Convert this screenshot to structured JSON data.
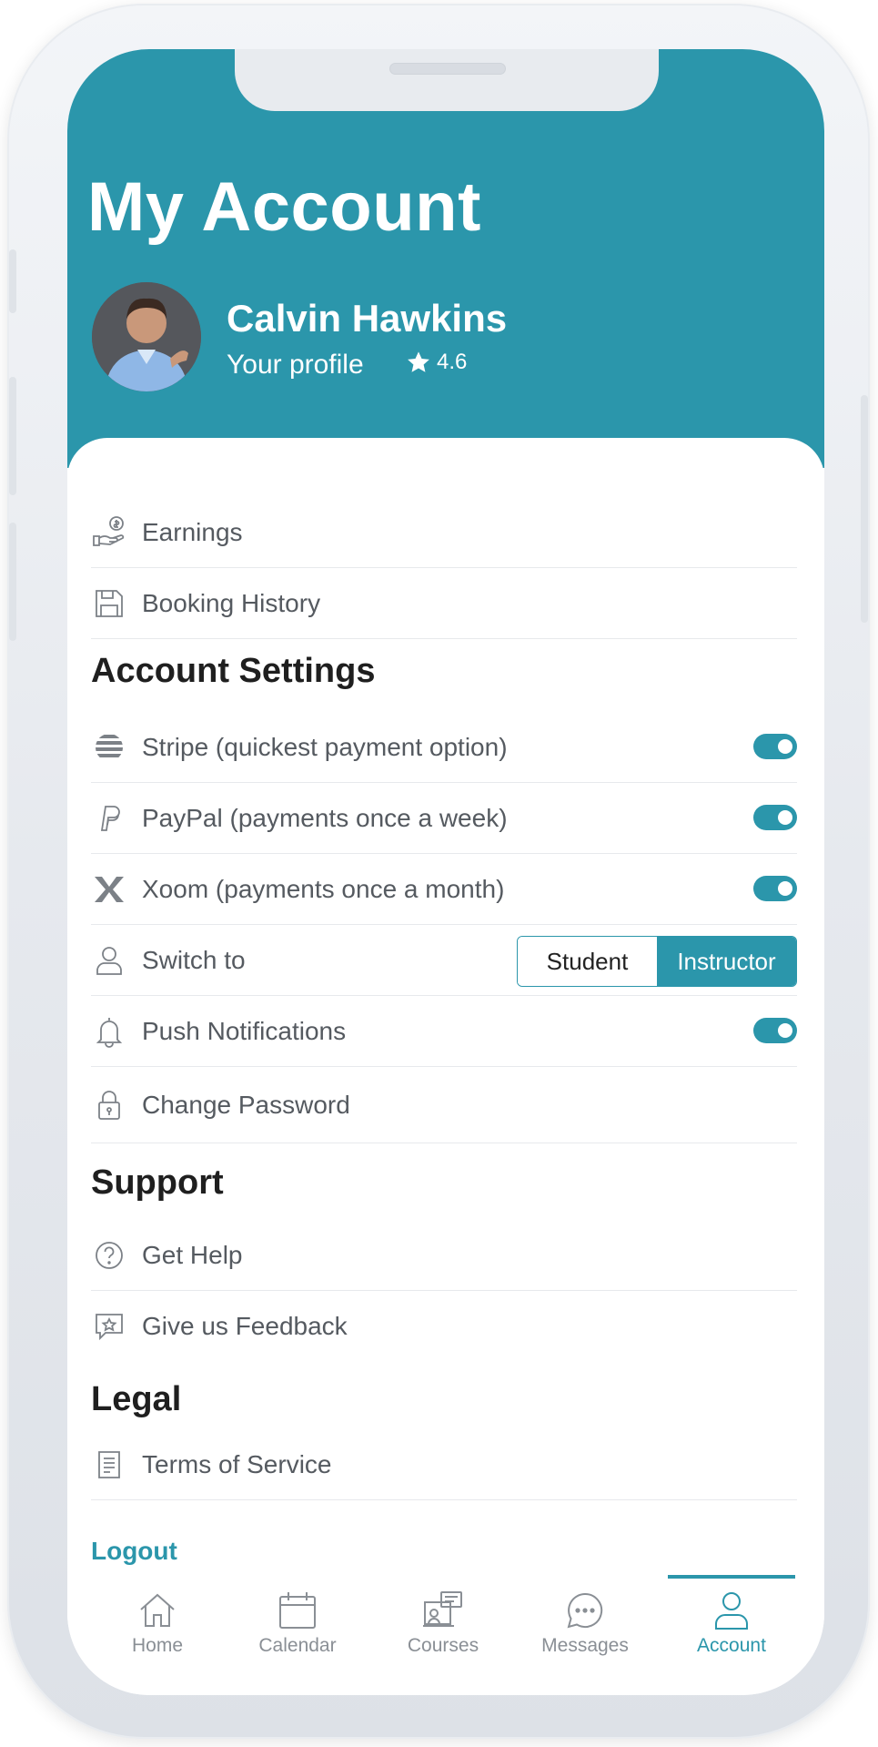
{
  "header": {
    "title": "My Account",
    "profile_name": "Calvin Hawkins",
    "profile_link": "Your profile",
    "rating": "4.6"
  },
  "quick_links": [
    {
      "label": "Earnings",
      "icon": "hand-coin-icon"
    },
    {
      "label": "Booking History",
      "icon": "floppy-disk-icon"
    }
  ],
  "account_settings": {
    "title": "Account Settings",
    "items": [
      {
        "label": "Stripe (quickest payment option)",
        "icon": "stripe-icon",
        "enabled": true
      },
      {
        "label": "PayPal (payments once a week)",
        "icon": "paypal-icon",
        "enabled": true
      },
      {
        "label": "Xoom (payments once a month)",
        "icon": "xoom-icon",
        "enabled": true
      }
    ],
    "switch_to": {
      "label": "Switch to",
      "icon": "user-icon",
      "options": [
        "Student",
        "Instructor"
      ],
      "selected": "Instructor"
    },
    "push": {
      "label": "Push Notifications",
      "icon": "bell-icon",
      "enabled": true
    },
    "password": {
      "label": "Change Password",
      "icon": "lock-icon"
    }
  },
  "support": {
    "title": "Support",
    "items": [
      {
        "label": "Get Help",
        "icon": "question-circle-icon"
      },
      {
        "label": "Give us Feedback",
        "icon": "feedback-star-icon"
      }
    ]
  },
  "legal": {
    "title": "Legal",
    "items": [
      {
        "label": "Terms of Service",
        "icon": "document-icon"
      }
    ]
  },
  "logout_label": "Logout",
  "tabbar": {
    "items": [
      {
        "label": "Home",
        "icon": "home-icon"
      },
      {
        "label": "Calendar",
        "icon": "calendar-icon"
      },
      {
        "label": "Courses",
        "icon": "courses-icon"
      },
      {
        "label": "Messages",
        "icon": "messages-icon"
      },
      {
        "label": "Account",
        "icon": "account-icon"
      }
    ],
    "active": "Account"
  },
  "colors": {
    "accent": "#2b96ab",
    "text": "#555a60",
    "heading": "#1f1f1f"
  }
}
